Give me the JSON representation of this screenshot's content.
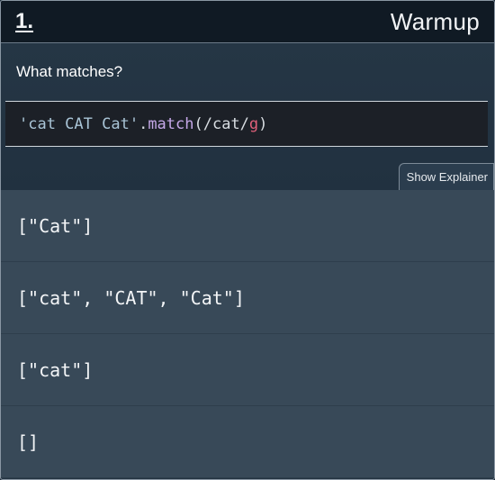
{
  "header": {
    "question_number": "1.",
    "title": "Warmup"
  },
  "question": {
    "prompt": "What matches?",
    "code_tokens": [
      {
        "text": "'cat CAT Cat'",
        "kind": "string"
      },
      {
        "text": ".",
        "kind": "punc"
      },
      {
        "text": "match",
        "kind": "function"
      },
      {
        "text": "(/cat/",
        "kind": "punc"
      },
      {
        "text": "g",
        "kind": "flag"
      },
      {
        "text": ")",
        "kind": "punc"
      }
    ]
  },
  "explainer_toggle": {
    "label": "Show Explainer"
  },
  "answers": [
    {
      "label": "[\"Cat\"]"
    },
    {
      "label": "[\"cat\", \"CAT\", \"Cat\"]"
    },
    {
      "label": "[\"cat\"]"
    },
    {
      "label": "[]"
    }
  ],
  "colors": {
    "header_bg": "#101a24",
    "code_bg": "#1c2027",
    "answer_bg": "#384958",
    "regex_flag": "#e0607a",
    "method_name": "#c4a7e7"
  }
}
